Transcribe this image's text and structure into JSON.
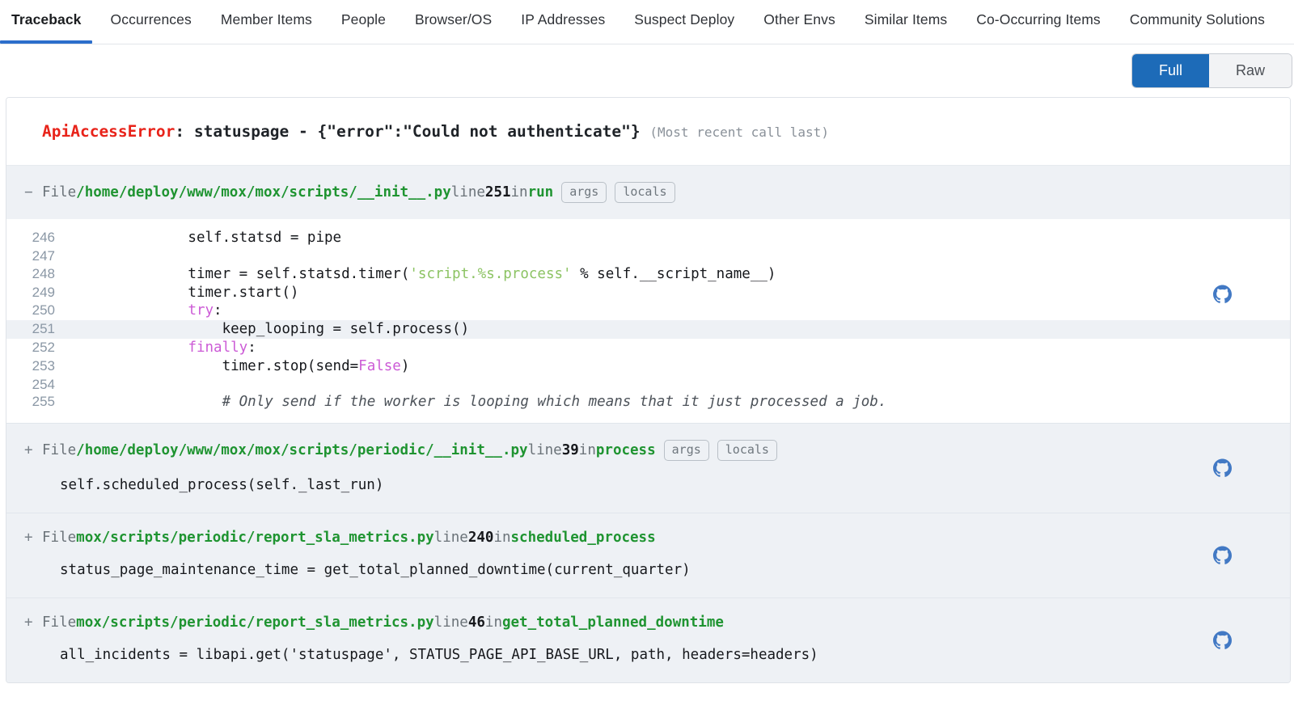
{
  "tabs": [
    {
      "label": "Traceback",
      "active": true
    },
    {
      "label": "Occurrences",
      "active": false
    },
    {
      "label": "Member Items",
      "active": false
    },
    {
      "label": "People",
      "active": false
    },
    {
      "label": "Browser/OS",
      "active": false
    },
    {
      "label": "IP Addresses",
      "active": false
    },
    {
      "label": "Suspect Deploy",
      "active": false
    },
    {
      "label": "Other Envs",
      "active": false
    },
    {
      "label": "Similar Items",
      "active": false
    },
    {
      "label": "Co-Occurring Items",
      "active": false
    },
    {
      "label": "Community Solutions",
      "active": false
    }
  ],
  "view_toggle": {
    "full_label": "Full",
    "raw_label": "Raw",
    "selected": "Full",
    "active_color": "#1d6bb8"
  },
  "exception": {
    "type": "ApiAccessError",
    "separator": ": ",
    "value": "statuspage - {\"error\":\"Could not authenticate\"}",
    "note": "(Most recent call last)",
    "type_color": "#e8231a"
  },
  "labels": {
    "file_kw": "File",
    "line_kw": "line",
    "in_kw": "in",
    "args_pill": "args",
    "locals_pill": "locals",
    "expand_sign": "+",
    "collapse_sign": "−",
    "github_icon": "github-icon"
  },
  "frames": [
    {
      "expanded": true,
      "sign": "−",
      "file": "/home/deploy/www/mox/mox/scripts/__init__.py",
      "line": "251",
      "function": "run",
      "has_pills": true,
      "has_github": true,
      "code": [
        {
          "num": "246",
          "current": false,
          "parts": [
            {
              "t": "            self.statsd = pipe",
              "c": "plain"
            }
          ]
        },
        {
          "num": "247",
          "current": false,
          "parts": [
            {
              "t": "",
              "c": "plain"
            }
          ]
        },
        {
          "num": "248",
          "current": false,
          "parts": [
            {
              "t": "            timer = self.statsd.timer(",
              "c": "plain"
            },
            {
              "t": "'script.%s.process'",
              "c": "str"
            },
            {
              "t": " % self.__script_name__)",
              "c": "plain"
            }
          ]
        },
        {
          "num": "249",
          "current": false,
          "parts": [
            {
              "t": "            timer.start()",
              "c": "plain"
            }
          ]
        },
        {
          "num": "250",
          "current": false,
          "parts": [
            {
              "t": "            ",
              "c": "plain"
            },
            {
              "t": "try",
              "c": "kw"
            },
            {
              "t": ":",
              "c": "plain"
            }
          ]
        },
        {
          "num": "251",
          "current": true,
          "parts": [
            {
              "t": "                keep_looping = self.process()",
              "c": "plain"
            }
          ]
        },
        {
          "num": "252",
          "current": false,
          "parts": [
            {
              "t": "            ",
              "c": "plain"
            },
            {
              "t": "finally",
              "c": "kw"
            },
            {
              "t": ":",
              "c": "plain"
            }
          ]
        },
        {
          "num": "253",
          "current": false,
          "parts": [
            {
              "t": "                timer.stop(send=",
              "c": "plain"
            },
            {
              "t": "False",
              "c": "const"
            },
            {
              "t": ")",
              "c": "plain"
            }
          ]
        },
        {
          "num": "254",
          "current": false,
          "parts": [
            {
              "t": "",
              "c": "plain"
            }
          ]
        },
        {
          "num": "255",
          "current": false,
          "parts": [
            {
              "t": "                ",
              "c": "plain"
            },
            {
              "t": "# Only send if the worker is looping which means that it just processed a job.",
              "c": "com"
            }
          ]
        }
      ]
    },
    {
      "expanded": false,
      "sign": "+",
      "file": "/home/deploy/www/mox/mox/scripts/periodic/__init__.py",
      "line": "39",
      "function": "process",
      "has_pills": true,
      "has_github": true,
      "preview": "self.scheduled_process(self._last_run)"
    },
    {
      "expanded": false,
      "sign": "+",
      "file": "mox/scripts/periodic/report_sla_metrics.py",
      "line": "240",
      "function": "scheduled_process",
      "has_pills": false,
      "has_github": true,
      "preview": "status_page_maintenance_time = get_total_planned_downtime(current_quarter)"
    },
    {
      "expanded": false,
      "sign": "+",
      "file": "mox/scripts/periodic/report_sla_metrics.py",
      "line": "46",
      "function": "get_total_planned_downtime",
      "has_pills": false,
      "has_github": true,
      "preview": "all_incidents = libapi.get('statuspage', STATUS_PAGE_API_BASE_URL, path, headers=headers)"
    }
  ]
}
